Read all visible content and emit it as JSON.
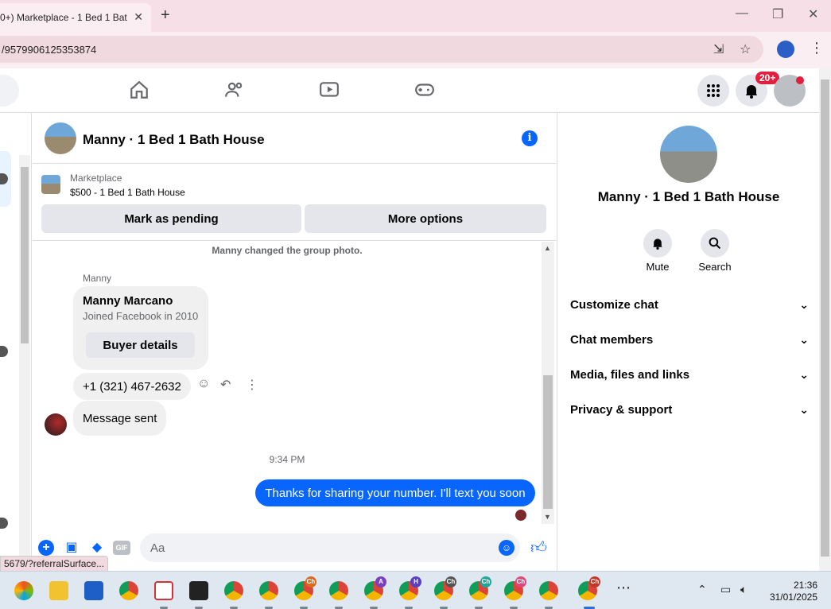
{
  "browser": {
    "tab_title": "0+) Marketplace - 1 Bed 1 Bat",
    "tab_close": "✕",
    "new_tab": "+",
    "url": "/9579906125353874",
    "status_url": "5679/?referralSurface..."
  },
  "fb_header": {
    "notif_badge": "20+"
  },
  "chat": {
    "title": "Manny · 1 Bed 1 Bath House",
    "marketplace_label": "Marketplace",
    "listing": "$500 - 1 Bed 1 Bath House",
    "mark_pending": "Mark as pending",
    "more_options": "More options",
    "system_msg": "Manny changed the group photo.",
    "sender": "Manny",
    "card_name": "Manny Marcano",
    "card_joined": "Joined Facebook in 2010",
    "buyer_details": "Buyer details",
    "phone_msg": "+1 (321) 467-2632",
    "sent_msg": "Message sent",
    "timestamp": "9:34 PM",
    "my_msg": "Thanks for sharing your number. I'll text you soon",
    "composer_placeholder": "Aa",
    "gif_label": "GIF"
  },
  "right_panel": {
    "name": "Manny · 1 Bed 1 Bath House",
    "mute": "Mute",
    "search": "Search",
    "items": [
      "Customize chat",
      "Chat members",
      "Media, files and links",
      "Privacy & support"
    ]
  },
  "taskbar": {
    "time": "21:36",
    "date": "31/01/2025"
  },
  "colors": {
    "accent": "#0866ff",
    "notification": "#e41e3f"
  }
}
